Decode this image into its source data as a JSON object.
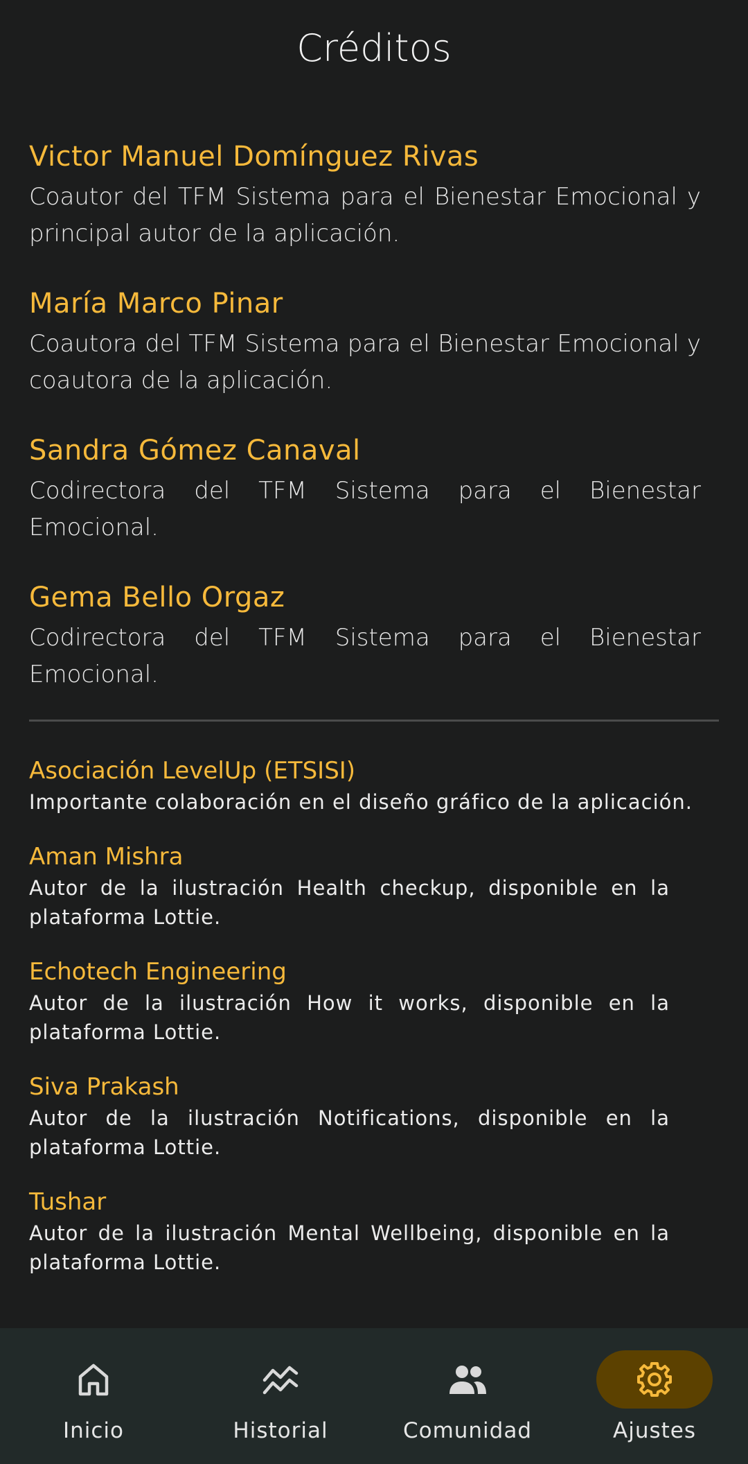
{
  "header": {
    "title": "Créditos"
  },
  "authors": [
    {
      "name": "Victor Manuel Domínguez Rivas",
      "description": "Coautor del TFM Sistema para el Bienestar Emocional y principal autor de la aplicación."
    },
    {
      "name": "María Marco Pinar",
      "description": "Coautora del TFM Sistema para el Bienestar Emocional y coautora de la aplicación."
    },
    {
      "name": "Sandra Gómez Canaval",
      "description": "Codirectora del TFM Sistema para el Bienestar Emocional."
    },
    {
      "name": "Gema Bello Orgaz",
      "description": "Codirectora del TFM Sistema para el Bienestar Emocional."
    }
  ],
  "collaborators": [
    {
      "name": "Asociación LevelUp (ETSISI)",
      "description": "Importante colaboración en el diseño gráfico de la aplicación."
    },
    {
      "name": "Aman Mishra",
      "description": "Autor de la ilustración Health checkup, disponible en la plataforma Lottie."
    },
    {
      "name": "Echotech Engineering",
      "description": "Autor de la ilustración How it works, disponible en la plataforma Lottie."
    },
    {
      "name": "Siva Prakash",
      "description": "Autor de la ilustración Notifications, disponible en la plataforma Lottie."
    },
    {
      "name": "Tushar",
      "description": "Autor de la ilustración Mental Wellbeing, disponible en la plataforma Lottie."
    }
  ],
  "nav": {
    "items": [
      {
        "label": "Inicio",
        "icon": "home-icon"
      },
      {
        "label": "Historial",
        "icon": "history-icon"
      },
      {
        "label": "Comunidad",
        "icon": "community-icon"
      },
      {
        "label": "Ajustes",
        "icon": "settings-icon"
      }
    ],
    "active": "Ajustes"
  },
  "colors": {
    "background": "#1c1d1d",
    "accent": "#f6b93b",
    "navbar": "#222a29",
    "active_pill": "#5c4100"
  }
}
